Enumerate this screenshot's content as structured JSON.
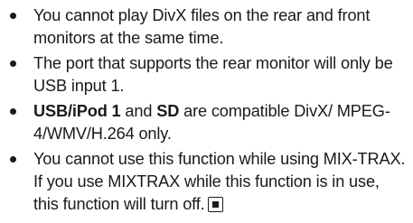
{
  "notes": [
    {
      "parts": [
        {
          "text": "You cannot play DivX files on the rear and front monitors at the same time.",
          "bold": false
        }
      ]
    },
    {
      "parts": [
        {
          "text": "The port that supports the rear monitor will only be USB input 1.",
          "bold": false
        }
      ]
    },
    {
      "parts": [
        {
          "text": "USB/iPod 1",
          "bold": true
        },
        {
          "text": " and ",
          "bold": false
        },
        {
          "text": "SD",
          "bold": true
        },
        {
          "text": " are compatible DivX/ MPEG-4/WMV/H.264 only.",
          "bold": false
        }
      ]
    },
    {
      "parts": [
        {
          "text": "You cannot use this function while using MIX-TRAX. If you use MIXTRAX while this function is in use, this function will turn off.",
          "bold": false
        }
      ],
      "end_mark_icon": "end-of-section-icon"
    }
  ]
}
